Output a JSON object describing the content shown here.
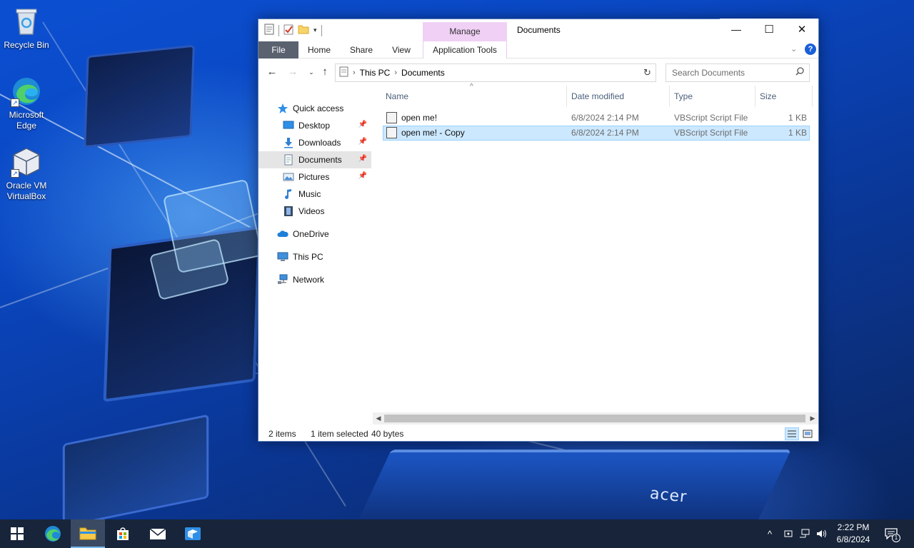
{
  "desktop": {
    "icons": [
      {
        "label": "Recycle Bin"
      },
      {
        "label": "Microsoft Edge"
      },
      {
        "label": "Oracle VM VirtualBox"
      }
    ],
    "wallpaper_brand": "acer"
  },
  "window": {
    "title": "Documents",
    "manage_tab": "Manage",
    "controls": {
      "minimize": "—",
      "maximize": "☐",
      "close": "✕"
    },
    "ribbon_tabs": [
      "File",
      "Home",
      "Share",
      "View",
      "Application Tools"
    ],
    "address": {
      "crumbs": [
        "This PC",
        "Documents"
      ]
    },
    "search": {
      "placeholder": "Search Documents"
    },
    "nav_pane": {
      "items": [
        {
          "label": "Quick access",
          "icon": "star-icon"
        },
        {
          "label": "Desktop",
          "icon": "desktop-folder-icon",
          "pinned": true
        },
        {
          "label": "Downloads",
          "icon": "download-arrow-icon",
          "pinned": true
        },
        {
          "label": "Documents",
          "icon": "document-folder-icon",
          "pinned": true,
          "selected": true
        },
        {
          "label": "Pictures",
          "icon": "pictures-folder-icon",
          "pinned": true
        },
        {
          "label": "Music",
          "icon": "music-note-icon"
        },
        {
          "label": "Videos",
          "icon": "film-icon"
        },
        {
          "label": "OneDrive",
          "icon": "cloud-icon"
        },
        {
          "label": "This PC",
          "icon": "computer-icon"
        },
        {
          "label": "Network",
          "icon": "network-icon"
        }
      ]
    },
    "columns": [
      "Name",
      "Date modified",
      "Type",
      "Size"
    ],
    "files": [
      {
        "name": "open me!",
        "date": "6/8/2024 2:14 PM",
        "type": "VBScript Script File",
        "size": "1 KB",
        "selected": false
      },
      {
        "name": "open me! - Copy",
        "date": "6/8/2024 2:14 PM",
        "type": "VBScript Script File",
        "size": "1 KB",
        "selected": true
      }
    ],
    "status": {
      "count": "2 items",
      "selection": "1 item selected",
      "bytes": "40 bytes"
    }
  },
  "taskbar": {
    "apps": [
      "start-icon",
      "edge-icon",
      "file-explorer-icon",
      "store-icon",
      "mail-icon",
      "virtualbox-icon"
    ],
    "active_app": "file-explorer-icon",
    "clock": {
      "time": "2:22 PM",
      "date": "6/8/2024"
    },
    "notifications": "1"
  },
  "colors": {
    "selection": "#cce8ff",
    "manage_tab": "#f0d0f5",
    "file_tab": "#5a6270",
    "taskbar": "#17243a",
    "accent": "#1a5fd8"
  }
}
